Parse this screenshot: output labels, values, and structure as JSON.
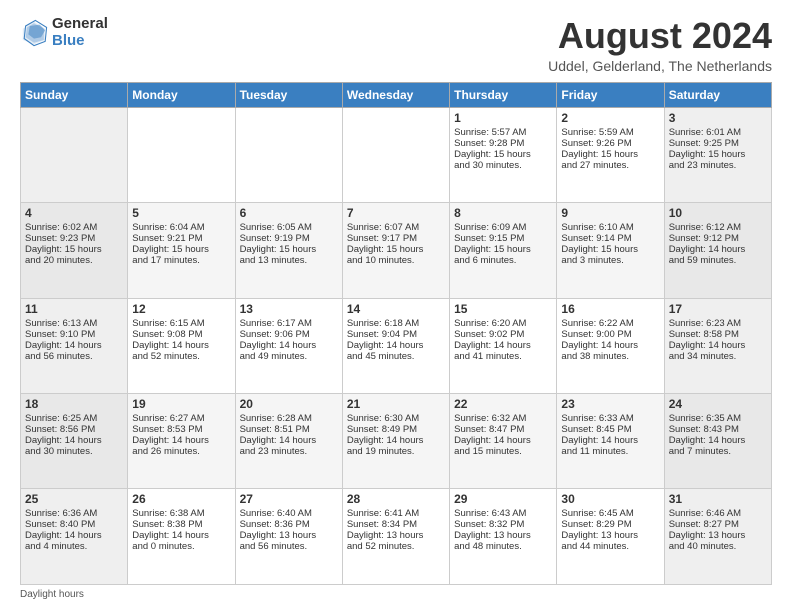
{
  "header": {
    "logo_line1": "General",
    "logo_line2": "Blue",
    "month_title": "August 2024",
    "location": "Uddel, Gelderland, The Netherlands"
  },
  "days_of_week": [
    "Sunday",
    "Monday",
    "Tuesday",
    "Wednesday",
    "Thursday",
    "Friday",
    "Saturday"
  ],
  "weeks": [
    [
      {
        "day": "",
        "info": ""
      },
      {
        "day": "",
        "info": ""
      },
      {
        "day": "",
        "info": ""
      },
      {
        "day": "",
        "info": ""
      },
      {
        "day": "1",
        "info": "Sunrise: 5:57 AM\nSunset: 9:28 PM\nDaylight: 15 hours\nand 30 minutes."
      },
      {
        "day": "2",
        "info": "Sunrise: 5:59 AM\nSunset: 9:26 PM\nDaylight: 15 hours\nand 27 minutes."
      },
      {
        "day": "3",
        "info": "Sunrise: 6:01 AM\nSunset: 9:25 PM\nDaylight: 15 hours\nand 23 minutes."
      }
    ],
    [
      {
        "day": "4",
        "info": "Sunrise: 6:02 AM\nSunset: 9:23 PM\nDaylight: 15 hours\nand 20 minutes."
      },
      {
        "day": "5",
        "info": "Sunrise: 6:04 AM\nSunset: 9:21 PM\nDaylight: 15 hours\nand 17 minutes."
      },
      {
        "day": "6",
        "info": "Sunrise: 6:05 AM\nSunset: 9:19 PM\nDaylight: 15 hours\nand 13 minutes."
      },
      {
        "day": "7",
        "info": "Sunrise: 6:07 AM\nSunset: 9:17 PM\nDaylight: 15 hours\nand 10 minutes."
      },
      {
        "day": "8",
        "info": "Sunrise: 6:09 AM\nSunset: 9:15 PM\nDaylight: 15 hours\nand 6 minutes."
      },
      {
        "day": "9",
        "info": "Sunrise: 6:10 AM\nSunset: 9:14 PM\nDaylight: 15 hours\nand 3 minutes."
      },
      {
        "day": "10",
        "info": "Sunrise: 6:12 AM\nSunset: 9:12 PM\nDaylight: 14 hours\nand 59 minutes."
      }
    ],
    [
      {
        "day": "11",
        "info": "Sunrise: 6:13 AM\nSunset: 9:10 PM\nDaylight: 14 hours\nand 56 minutes."
      },
      {
        "day": "12",
        "info": "Sunrise: 6:15 AM\nSunset: 9:08 PM\nDaylight: 14 hours\nand 52 minutes."
      },
      {
        "day": "13",
        "info": "Sunrise: 6:17 AM\nSunset: 9:06 PM\nDaylight: 14 hours\nand 49 minutes."
      },
      {
        "day": "14",
        "info": "Sunrise: 6:18 AM\nSunset: 9:04 PM\nDaylight: 14 hours\nand 45 minutes."
      },
      {
        "day": "15",
        "info": "Sunrise: 6:20 AM\nSunset: 9:02 PM\nDaylight: 14 hours\nand 41 minutes."
      },
      {
        "day": "16",
        "info": "Sunrise: 6:22 AM\nSunset: 9:00 PM\nDaylight: 14 hours\nand 38 minutes."
      },
      {
        "day": "17",
        "info": "Sunrise: 6:23 AM\nSunset: 8:58 PM\nDaylight: 14 hours\nand 34 minutes."
      }
    ],
    [
      {
        "day": "18",
        "info": "Sunrise: 6:25 AM\nSunset: 8:56 PM\nDaylight: 14 hours\nand 30 minutes."
      },
      {
        "day": "19",
        "info": "Sunrise: 6:27 AM\nSunset: 8:53 PM\nDaylight: 14 hours\nand 26 minutes."
      },
      {
        "day": "20",
        "info": "Sunrise: 6:28 AM\nSunset: 8:51 PM\nDaylight: 14 hours\nand 23 minutes."
      },
      {
        "day": "21",
        "info": "Sunrise: 6:30 AM\nSunset: 8:49 PM\nDaylight: 14 hours\nand 19 minutes."
      },
      {
        "day": "22",
        "info": "Sunrise: 6:32 AM\nSunset: 8:47 PM\nDaylight: 14 hours\nand 15 minutes."
      },
      {
        "day": "23",
        "info": "Sunrise: 6:33 AM\nSunset: 8:45 PM\nDaylight: 14 hours\nand 11 minutes."
      },
      {
        "day": "24",
        "info": "Sunrise: 6:35 AM\nSunset: 8:43 PM\nDaylight: 14 hours\nand 7 minutes."
      }
    ],
    [
      {
        "day": "25",
        "info": "Sunrise: 6:36 AM\nSunset: 8:40 PM\nDaylight: 14 hours\nand 4 minutes."
      },
      {
        "day": "26",
        "info": "Sunrise: 6:38 AM\nSunset: 8:38 PM\nDaylight: 14 hours\nand 0 minutes."
      },
      {
        "day": "27",
        "info": "Sunrise: 6:40 AM\nSunset: 8:36 PM\nDaylight: 13 hours\nand 56 minutes."
      },
      {
        "day": "28",
        "info": "Sunrise: 6:41 AM\nSunset: 8:34 PM\nDaylight: 13 hours\nand 52 minutes."
      },
      {
        "day": "29",
        "info": "Sunrise: 6:43 AM\nSunset: 8:32 PM\nDaylight: 13 hours\nand 48 minutes."
      },
      {
        "day": "30",
        "info": "Sunrise: 6:45 AM\nSunset: 8:29 PM\nDaylight: 13 hours\nand 44 minutes."
      },
      {
        "day": "31",
        "info": "Sunrise: 6:46 AM\nSunset: 8:27 PM\nDaylight: 13 hours\nand 40 minutes."
      }
    ]
  ],
  "footer": {
    "note": "Daylight hours"
  }
}
